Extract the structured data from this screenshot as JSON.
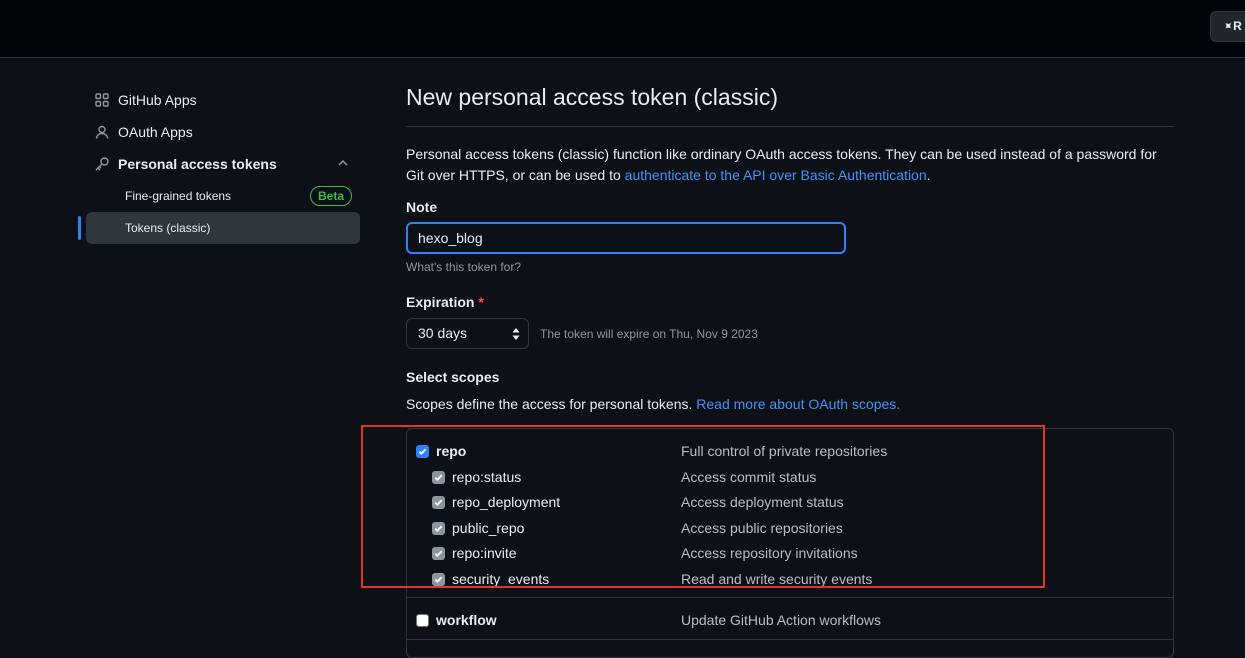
{
  "topbar": {
    "button_label": "R"
  },
  "sidebar": {
    "items": [
      {
        "label": "GitHub Apps",
        "icon": "apps-icon"
      },
      {
        "label": "OAuth Apps",
        "icon": "person-icon"
      },
      {
        "label": "Personal access tokens",
        "icon": "key-icon"
      }
    ],
    "sub_items": [
      {
        "label": "Fine-grained tokens",
        "badge": "Beta"
      },
      {
        "label": "Tokens (classic)"
      }
    ]
  },
  "main": {
    "title": "New personal access token (classic)",
    "description_text": "Personal access tokens (classic) function like ordinary OAuth access tokens. They can be used instead of a password for Git over HTTPS, or can be used to ",
    "description_link": "authenticate to the API over Basic Authentication",
    "description_end": ".",
    "note_label": "Note",
    "note_value": "hexo_blog",
    "note_hint": "What's this token for?",
    "expiration_label": "Expiration",
    "expiration_required": "*",
    "expiration_value": "30 days",
    "expiration_text": "The token will expire on Thu, Nov 9 2023",
    "scopes_label": "Select scopes",
    "scopes_desc_text": "Scopes define the access for personal tokens. ",
    "scopes_desc_link": "Read more about OAuth scopes."
  },
  "scopes": [
    {
      "name": "repo",
      "desc": "Full control of private repositories",
      "checked": true,
      "parent": true
    },
    {
      "name": "repo:status",
      "desc": "Access commit status",
      "checked": true
    },
    {
      "name": "repo_deployment",
      "desc": "Access deployment status",
      "checked": true
    },
    {
      "name": "public_repo",
      "desc": "Access public repositories",
      "checked": true
    },
    {
      "name": "repo:invite",
      "desc": "Access repository invitations",
      "checked": true
    },
    {
      "name": "security_events",
      "desc": "Read and write security events",
      "checked": true
    },
    {
      "name": "workflow",
      "desc": "Update GitHub Action workflows",
      "checked": false,
      "parent": true
    }
  ],
  "colors": {
    "background": "#0d1117",
    "accent": "#2f81f7",
    "link": "#4493f8",
    "highlight": "#e5322d",
    "success": "#3fb950"
  }
}
